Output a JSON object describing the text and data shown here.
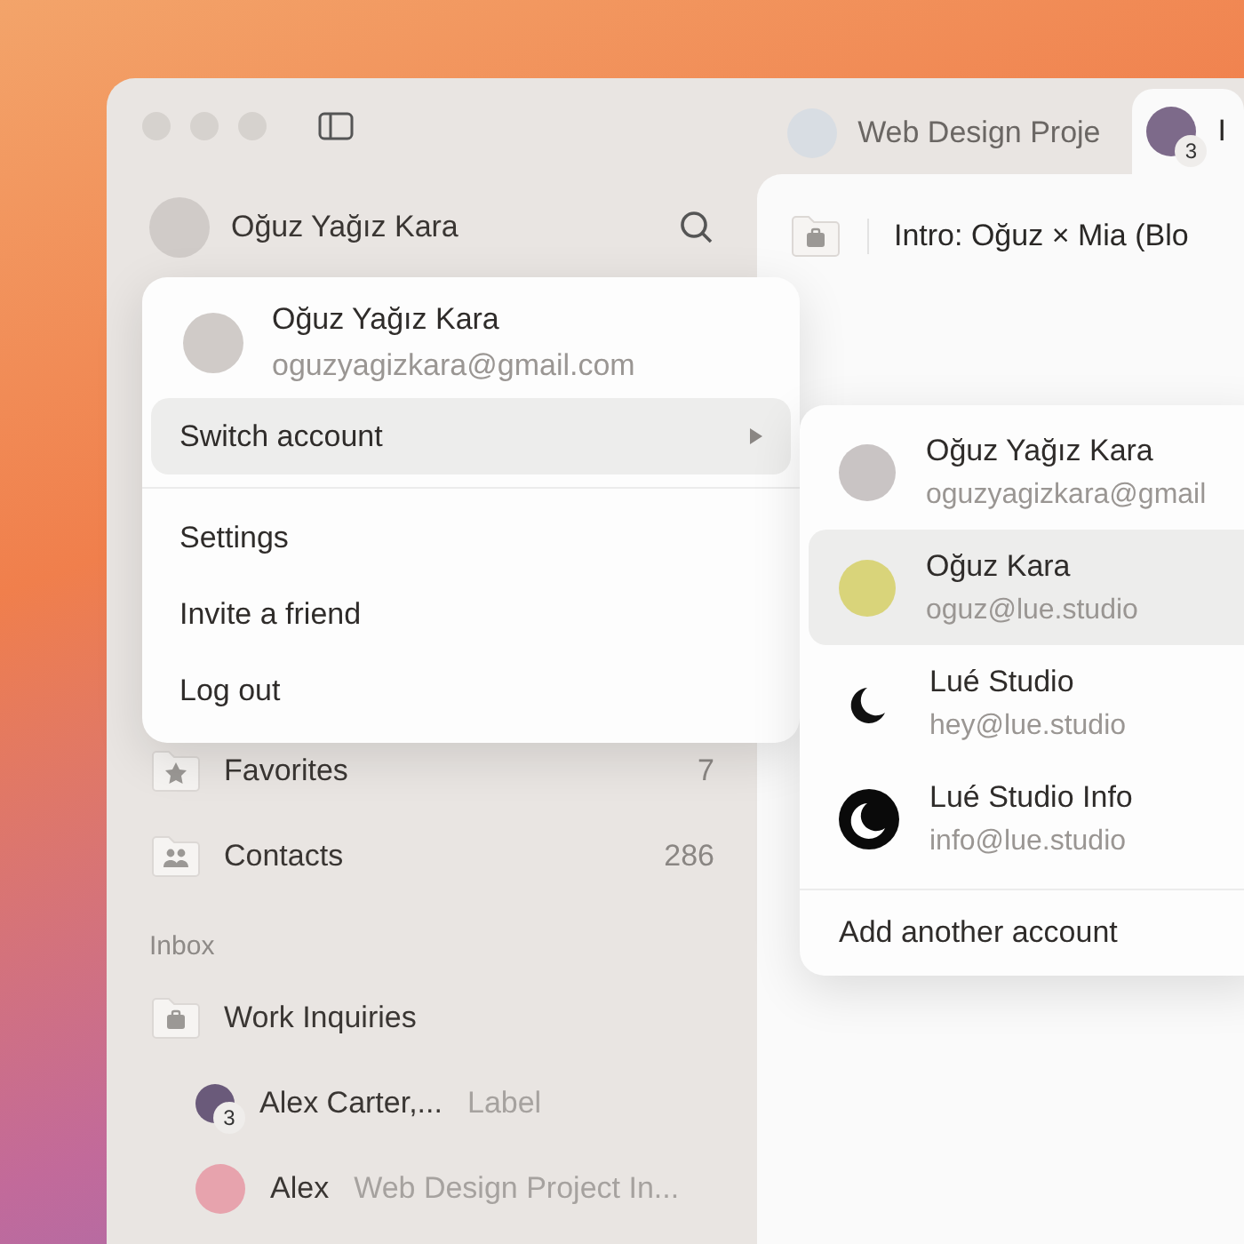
{
  "window": {
    "tabs": [
      {
        "label": "Web Design Proje",
        "selected": false
      },
      {
        "label": "I",
        "badge": "3",
        "selected": true
      }
    ]
  },
  "sidebar": {
    "account": {
      "name": "Oğuz Yağız Kara"
    },
    "items": [
      {
        "label": "Favorites",
        "count": "7",
        "kind": "favorites"
      },
      {
        "label": "Contacts",
        "count": "286",
        "kind": "contacts"
      }
    ],
    "section": "Inbox",
    "folder": {
      "label": "Work Inquiries"
    },
    "threads": [
      {
        "sender": "Alex Carter,...",
        "preview": "Label",
        "badge": "3"
      },
      {
        "sender": "Alex",
        "preview": "Web Design Project In..."
      }
    ]
  },
  "content": {
    "title": "Intro: Oğuz × Mia (Blo"
  },
  "account_menu": {
    "name": "Oğuz Yağız Kara",
    "email": "oguzyagizkara@gmail.com",
    "primary": {
      "label": "Switch account",
      "selected": true
    },
    "items": [
      {
        "label": "Settings"
      },
      {
        "label": "Invite a friend"
      },
      {
        "label": "Log out"
      }
    ]
  },
  "switch_menu": {
    "accounts": [
      {
        "name": "Oğuz Yağız Kara",
        "email": "oguzyagizkara@gmail",
        "kind": "photo",
        "selected": false
      },
      {
        "name": "Oğuz Kara",
        "email": "oguz@lue.studio",
        "kind": "photo",
        "selected": true
      },
      {
        "name": "Lué Studio",
        "email": "hey@lue.studio",
        "kind": "logo-light",
        "selected": false
      },
      {
        "name": "Lué Studio Info",
        "email": "info@lue.studio",
        "kind": "logo-dark",
        "selected": false
      }
    ],
    "add_label": "Add another account"
  }
}
